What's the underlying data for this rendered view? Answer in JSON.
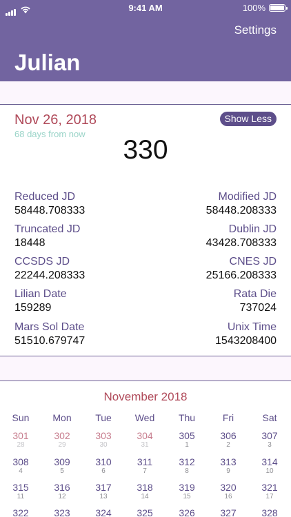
{
  "status": {
    "time": "9:41 AM",
    "battery": "100%",
    "battery_level": 1.0
  },
  "nav": {
    "settings_label": "Settings",
    "title": "Julian"
  },
  "date_card": {
    "date": "Nov 26, 2018",
    "relative": "68 days from now",
    "toggle_label": "Show Less",
    "day_of_year": "330",
    "items": [
      {
        "label": "Reduced JD",
        "value": "58448.708333"
      },
      {
        "label": "Modified JD",
        "value": "58448.208333"
      },
      {
        "label": "Truncated JD",
        "value": "18448"
      },
      {
        "label": "Dublin JD",
        "value": "43428.708333"
      },
      {
        "label": "CCSDS JD",
        "value": "22244.208333"
      },
      {
        "label": "CNES JD",
        "value": "25166.208333"
      },
      {
        "label": "Lilian Date",
        "value": "159289"
      },
      {
        "label": "Rata Die",
        "value": "737024"
      },
      {
        "label": "Mars Sol Date",
        "value": "51510.679747"
      },
      {
        "label": "Unix Time",
        "value": "1543208400"
      }
    ]
  },
  "calendar": {
    "month": "November 2018",
    "weekdays": [
      "Sun",
      "Mon",
      "Tue",
      "Wed",
      "Thu",
      "Fri",
      "Sat"
    ],
    "weeks": [
      [
        {
          "doy": "301",
          "dom": "28",
          "past": true
        },
        {
          "doy": "302",
          "dom": "29",
          "past": true
        },
        {
          "doy": "303",
          "dom": "30",
          "past": true
        },
        {
          "doy": "304",
          "dom": "31",
          "past": true
        },
        {
          "doy": "305",
          "dom": "1",
          "past": false
        },
        {
          "doy": "306",
          "dom": "2",
          "past": false
        },
        {
          "doy": "307",
          "dom": "3",
          "past": false
        }
      ],
      [
        {
          "doy": "308",
          "dom": "4",
          "past": false
        },
        {
          "doy": "309",
          "dom": "5",
          "past": false
        },
        {
          "doy": "310",
          "dom": "6",
          "past": false
        },
        {
          "doy": "311",
          "dom": "7",
          "past": false
        },
        {
          "doy": "312",
          "dom": "8",
          "past": false
        },
        {
          "doy": "313",
          "dom": "9",
          "past": false
        },
        {
          "doy": "314",
          "dom": "10",
          "past": false
        }
      ],
      [
        {
          "doy": "315",
          "dom": "11",
          "past": false
        },
        {
          "doy": "316",
          "dom": "12",
          "past": false
        },
        {
          "doy": "317",
          "dom": "13",
          "past": false
        },
        {
          "doy": "318",
          "dom": "14",
          "past": false
        },
        {
          "doy": "319",
          "dom": "15",
          "past": false
        },
        {
          "doy": "320",
          "dom": "16",
          "past": false
        },
        {
          "doy": "321",
          "dom": "17",
          "past": false
        }
      ],
      [
        {
          "doy": "322",
          "dom": "",
          "past": false
        },
        {
          "doy": "323",
          "dom": "",
          "past": false
        },
        {
          "doy": "324",
          "dom": "",
          "past": false
        },
        {
          "doy": "325",
          "dom": "",
          "past": false
        },
        {
          "doy": "326",
          "dom": "",
          "past": false
        },
        {
          "doy": "327",
          "dom": "",
          "past": false
        },
        {
          "doy": "328",
          "dom": "",
          "past": false
        }
      ]
    ]
  },
  "colors": {
    "header": "#7264a0",
    "accent": "#5d4e8a",
    "date_red": "#b04a5a",
    "relative_teal": "#9ad4c8",
    "background": "#fcf6fd"
  }
}
